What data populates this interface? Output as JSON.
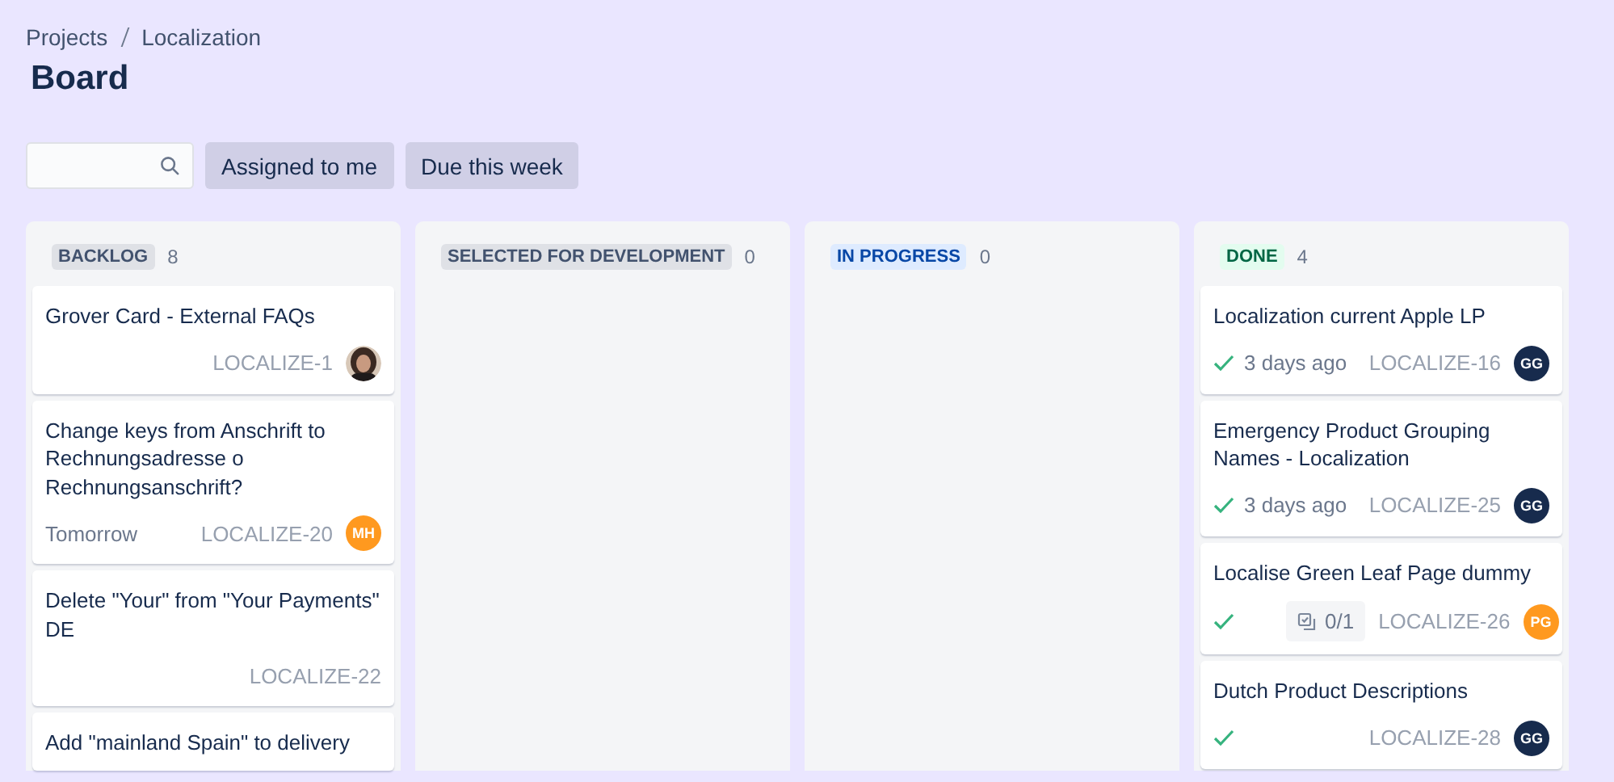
{
  "breadcrumbs": [
    "Projects",
    "Localization"
  ],
  "title": "Board",
  "filters": [
    {
      "label": "Assigned to me",
      "selected": false
    },
    {
      "label": "Due this week",
      "selected": false
    }
  ],
  "columns": [
    {
      "name": "BACKLOG",
      "kind": "default",
      "count": "8",
      "cards": [
        {
          "title": "Grover Card - External FAQs",
          "key": "LOCALIZE-1",
          "done": false
        },
        {
          "title": "Change keys from Anschrift to Rechnungsadresse o Rechnungsanschrift?",
          "due": "Tomorrow",
          "key": "LOCALIZE-20",
          "done": false,
          "avatar": {
            "kind": "initials",
            "initials": "MH",
            "color": "#ff991f"
          }
        },
        {
          "title": "Delete \"Your\" from \"Your Payments\" DE",
          "key": "LOCALIZE-22",
          "done": false
        },
        {
          "title": "Add \"mainland Spain\" to delivery",
          "done": false
        }
      ]
    },
    {
      "name": "SELECTED FOR DEVELOPMENT",
      "kind": "default",
      "count": "0"
    },
    {
      "name": "IN PROGRESS",
      "kind": "info",
      "count": "0"
    },
    {
      "name": "DONE",
      "kind": "success",
      "count": "4",
      "cards": [
        {
          "title": "Localization current Apple LP",
          "done": true,
          "due": "3 days ago",
          "key": "LOCALIZE-16",
          "avatar": {
            "kind": "initials",
            "initials": "GG",
            "color": "#172b4d"
          }
        },
        {
          "title": "Emergency Product Grouping Names - Localization",
          "done": true,
          "due": "3 days ago",
          "key": "LOCALIZE-25",
          "avatar": {
            "kind": "initials",
            "initials": "GG",
            "color": "#172b4d"
          }
        },
        {
          "title": "Localise Green Leaf Page dummy",
          "done": true,
          "subtasks": "0/1",
          "key": "LOCALIZE-26",
          "avatar": {
            "kind": "initials",
            "initials": "PG",
            "color": "#ff991f"
          }
        },
        {
          "title": "Dutch Product Descriptions",
          "done": true,
          "key": "LOCALIZE-28",
          "avatar": {
            "kind": "initials",
            "initials": "GG",
            "color": "#172b4d"
          }
        }
      ]
    }
  ]
}
